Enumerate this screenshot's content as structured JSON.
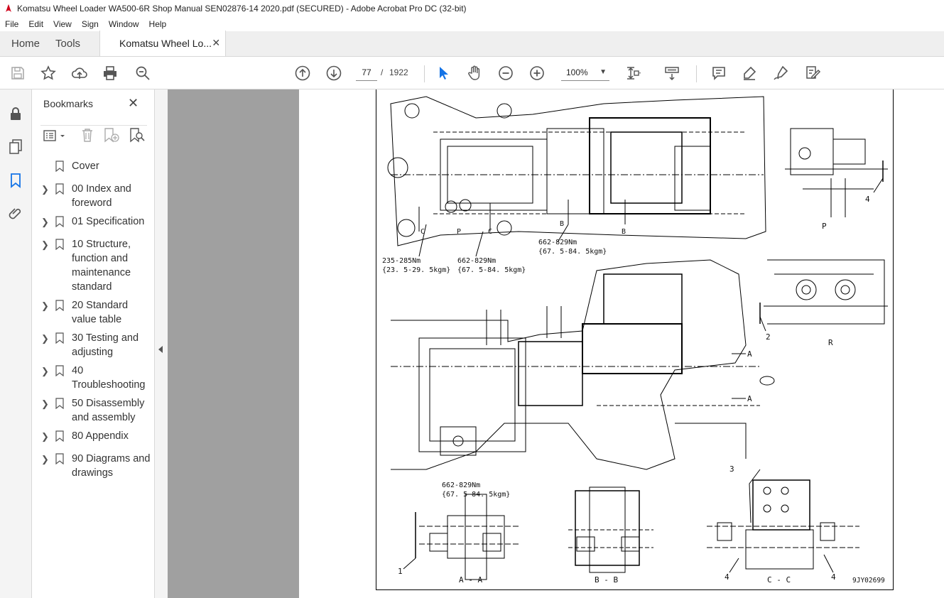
{
  "window": {
    "title": "Komatsu Wheel Loader WA500-6R Shop Manual SEN02876-14 2020.pdf (SECURED) - Adobe Acrobat Pro DC (32-bit)"
  },
  "menu": [
    "File",
    "Edit",
    "View",
    "Sign",
    "Window",
    "Help"
  ],
  "tabs": {
    "home": "Home",
    "tools": "Tools",
    "document": "Komatsu Wheel Lo..."
  },
  "toolbar": {
    "page_current": "77",
    "page_separator": "/",
    "page_total": "1922",
    "zoom": "100%"
  },
  "bookmarks": {
    "title": "Bookmarks",
    "items": [
      {
        "label": "Cover",
        "expandable": false
      },
      {
        "label": "00 Index and foreword",
        "expandable": true
      },
      {
        "label": "01 Specification",
        "expandable": true
      },
      {
        "label": "10 Structure, function and maintenance standard",
        "expandable": true
      },
      {
        "label": "20 Standard value table",
        "expandable": true
      },
      {
        "label": "30 Testing and adjusting",
        "expandable": true
      },
      {
        "label": "40 Troubleshooting",
        "expandable": true
      },
      {
        "label": "50 Disassembly and assembly",
        "expandable": true
      },
      {
        "label": "80 Appendix",
        "expandable": true
      },
      {
        "label": "90 Diagrams and drawings",
        "expandable": true
      }
    ]
  },
  "drawing": {
    "callouts": {
      "torque_cc_nm": "235-285Nm",
      "torque_cc_kgm": "{23. 5-29. 5kgm}",
      "torque_p_nm": "662-829Nm",
      "torque_p_kgm": "{67. 5-84. 5kgm}",
      "torque_b_nm": "662-829Nm",
      "torque_b_kgm": "{67. 5-84. 5kgm}",
      "torque_aa_nm": "662-829Nm",
      "torque_aa_kgm": "{67. 5-84. 5kgm}"
    },
    "labels": {
      "c1": "C",
      "p1": "P",
      "c2": "C",
      "b1": "B",
      "b2": "B",
      "p_view": "P",
      "r_view": "R",
      "a1": "A",
      "a2": "A",
      "n4a": "4",
      "n2": "2",
      "n3": "3",
      "n1": "1",
      "n4b": "4",
      "n4c": "4",
      "aa": "A - A",
      "bb": "B - B",
      "cc": "C - C",
      "figure_id": "9JY02699"
    }
  },
  "colors": {
    "acrobat_red": "#d0021b",
    "active_blue": "#1473e6",
    "gray_pane": "#a0a0a0"
  }
}
